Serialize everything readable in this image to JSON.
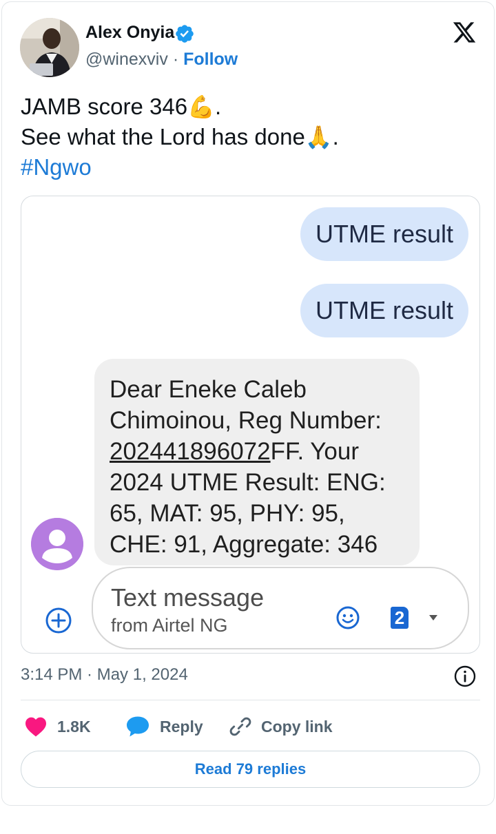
{
  "author": {
    "name": "Alex Onyia",
    "handle": "@winexviv",
    "separator": "·",
    "follow_label": "Follow",
    "verified": true
  },
  "tweet": {
    "line1_text": "JAMB score 346",
    "line1_emoji": "💪",
    "line1_end": ".",
    "line2_text": "See what the Lord has done",
    "line2_emoji": "🙏",
    "line2_end": ".",
    "hashtag": "#Ngwo"
  },
  "screenshot": {
    "outgoing_messages": [
      "UTME result",
      "UTME result"
    ],
    "incoming_message": {
      "part1": "Dear Eneke Caleb Chimoinou, Reg Number: ",
      "reg_number": "202441896072",
      "part2": "FF. Your 2024 UTME Result: ENG: 65, MAT: 95, PHY: 95, CHE: 91, Aggregate: 346"
    },
    "compose_placeholder": "Text message",
    "compose_sub": "from Airtel NG",
    "sim_number": "2"
  },
  "meta": {
    "timestamp": "3:14 PM · May 1, 2024"
  },
  "actions": {
    "likes": "1.8K",
    "reply_label": "Reply",
    "copy_label": "Copy link",
    "read_replies_label": "Read 79 replies"
  },
  "colors": {
    "link_blue": "#1d7bd6",
    "like_pink": "#f91880",
    "bubble_out": "#d7e6fb",
    "bubble_in": "#efefef",
    "contact_avatar": "#b57ce0"
  },
  "icons": {
    "logo": "x-logo-icon",
    "verified": "verified-badge-icon",
    "info": "info-icon",
    "like": "heart-icon",
    "reply": "reply-bubble-icon",
    "copy": "link-icon",
    "add": "add-circle-icon",
    "emoji": "emoji-smile-icon",
    "sim": "sim-card-icon"
  }
}
